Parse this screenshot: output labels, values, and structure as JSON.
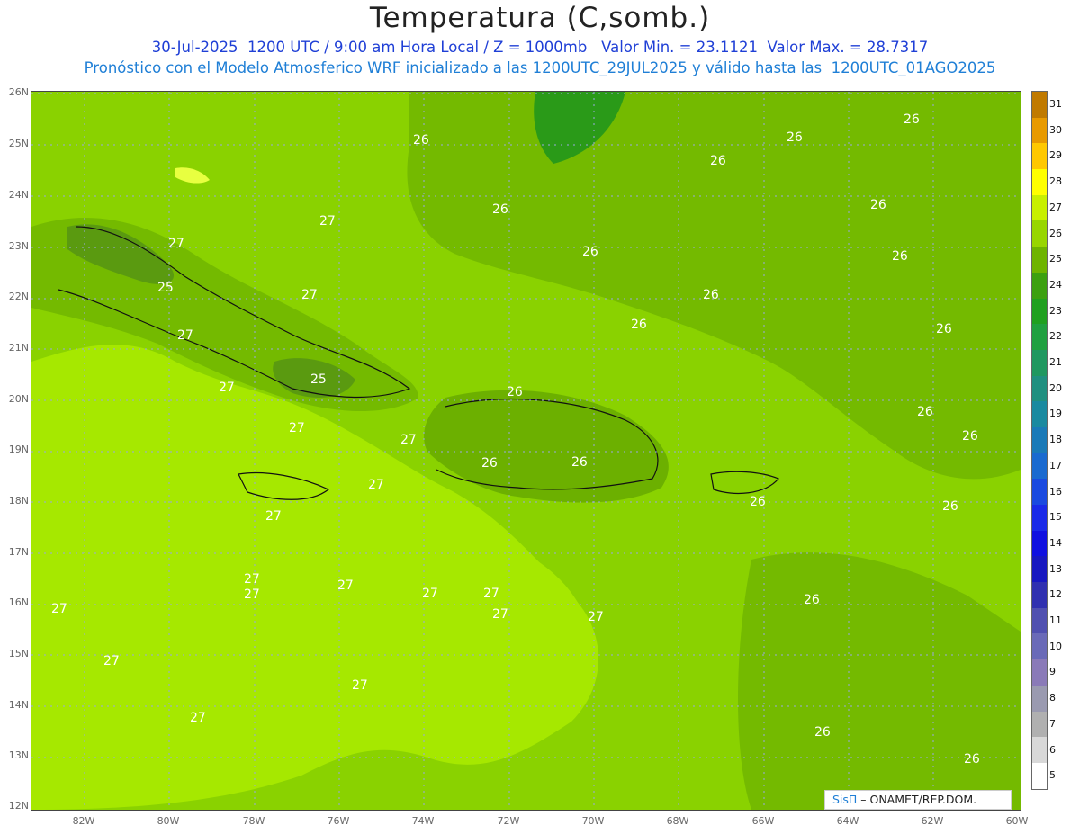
{
  "title": "Temperatura (C,somb.)",
  "subtitle1": "30-Jul-2025  1200 UTC / 9:00 am Hora Local / Z = 1000mb   Valor Min. = 23.1121  Valor Max. = 28.7317",
  "subtitle2": "Pronóstico con el Modelo Atmosferico WRF inicializado a las 1200UTC_29JUL2025 y válido hasta las  1200UTC_01AGO2025",
  "credit": {
    "brand": "SisΠ",
    "text": "– ONAMET/REP.DOM."
  },
  "map": {
    "lat_labels": [
      "26N",
      "25N",
      "24N",
      "23N",
      "22N",
      "21N",
      "20N",
      "19N",
      "18N",
      "17N",
      "16N",
      "15N",
      "14N",
      "13N",
      "12N"
    ],
    "lon_labels": [
      "82W",
      "80W",
      "78W",
      "76W",
      "74W",
      "72W",
      "70W",
      "68W",
      "66W",
      "64W",
      "62W",
      "60W"
    ],
    "contour_labels": [
      "26",
      "26",
      "26",
      "26",
      "26",
      "26",
      "26",
      "26",
      "26",
      "26",
      "26",
      "26",
      "26",
      "26",
      "26",
      "26",
      "26",
      "26",
      "26",
      "26",
      "26",
      "25",
      "25",
      "27",
      "27",
      "27",
      "27",
      "27",
      "27",
      "27",
      "27",
      "27",
      "27",
      "27",
      "27",
      "27",
      "27",
      "27",
      "27",
      "27",
      "27",
      "27",
      "27"
    ],
    "colors": {
      "c25": "#5e9e10",
      "c26": "#7ab800",
      "c27": "#98d600",
      "c28": "#b8f000",
      "c24": "#2a9a18"
    }
  },
  "colorbar": {
    "labels": [
      "31",
      "30",
      "29",
      "28",
      "27",
      "26",
      "25",
      "24",
      "23",
      "22",
      "21",
      "20",
      "19",
      "18",
      "17",
      "16",
      "15",
      "14",
      "13",
      "12",
      "11",
      "10",
      "9",
      "8",
      "7",
      "6",
      "5"
    ],
    "colors": [
      "#c07a00",
      "#e89a00",
      "#ffc800",
      "#ffff00",
      "#c8f000",
      "#98d600",
      "#6eb400",
      "#3ca010",
      "#20a020",
      "#20a040",
      "#209860",
      "#209080",
      "#1a8aa0",
      "#1a7ab8",
      "#1a6ad0",
      "#1a4ae0",
      "#1a2ae8",
      "#1010e0",
      "#1818c0",
      "#3030b0",
      "#5050b0",
      "#6a6ab8",
      "#8a7ab8",
      "#9a9ab0",
      "#b0b0b0",
      "#d8d8d8",
      "#ffffff"
    ]
  }
}
